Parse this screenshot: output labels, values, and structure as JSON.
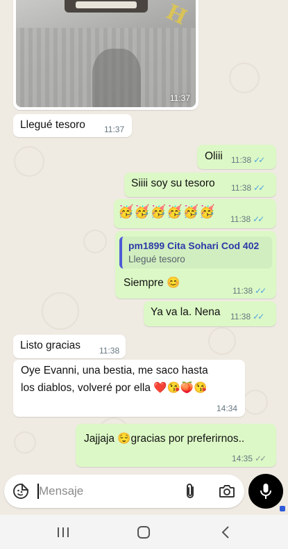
{
  "messages": {
    "image_time": "11:37",
    "m1": {
      "text": "Llegué tesoro",
      "time": "11:37"
    },
    "m2": {
      "text": "Oliii",
      "time": "11:38"
    },
    "m3": {
      "text": "Siiii soy su tesoro",
      "time": "11:38"
    },
    "m4": {
      "text": "🥳🥳🥳🥳🥳🥳",
      "time": "11:38"
    },
    "m5": {
      "quote_title": "pm1899 Cita Sohari Cod 402",
      "quote_text": "Llegué tesoro",
      "text": "Siempre 😊",
      "time": "11:38"
    },
    "m6": {
      "text": "Ya va la. Nena",
      "time": "11:38"
    },
    "m7": {
      "text": "Listo gracias",
      "time": "11:38"
    },
    "m8": {
      "line1": "Oye Evanni, una bestia, me saco hasta",
      "line2": "los diablos, volveré por ella ❤️😘🍑😘",
      "time": "14:34"
    },
    "m9": {
      "text": "Jajjaja 😌gracias por preferirnos..",
      "time": "14:35"
    }
  },
  "input": {
    "placeholder": "Mensaje"
  },
  "icons": {
    "read_ticks": "✓✓",
    "sticker": "sticker-icon",
    "attach": "paperclip-icon",
    "camera": "camera-icon",
    "mic": "microphone-icon",
    "recents": "recent-apps-icon",
    "home": "home-icon",
    "back": "back-icon"
  },
  "colors": {
    "incoming": "#ffffff",
    "outgoing": "#dcf8c6",
    "read_tick": "#4fa3e0",
    "background": "#efeae2"
  }
}
